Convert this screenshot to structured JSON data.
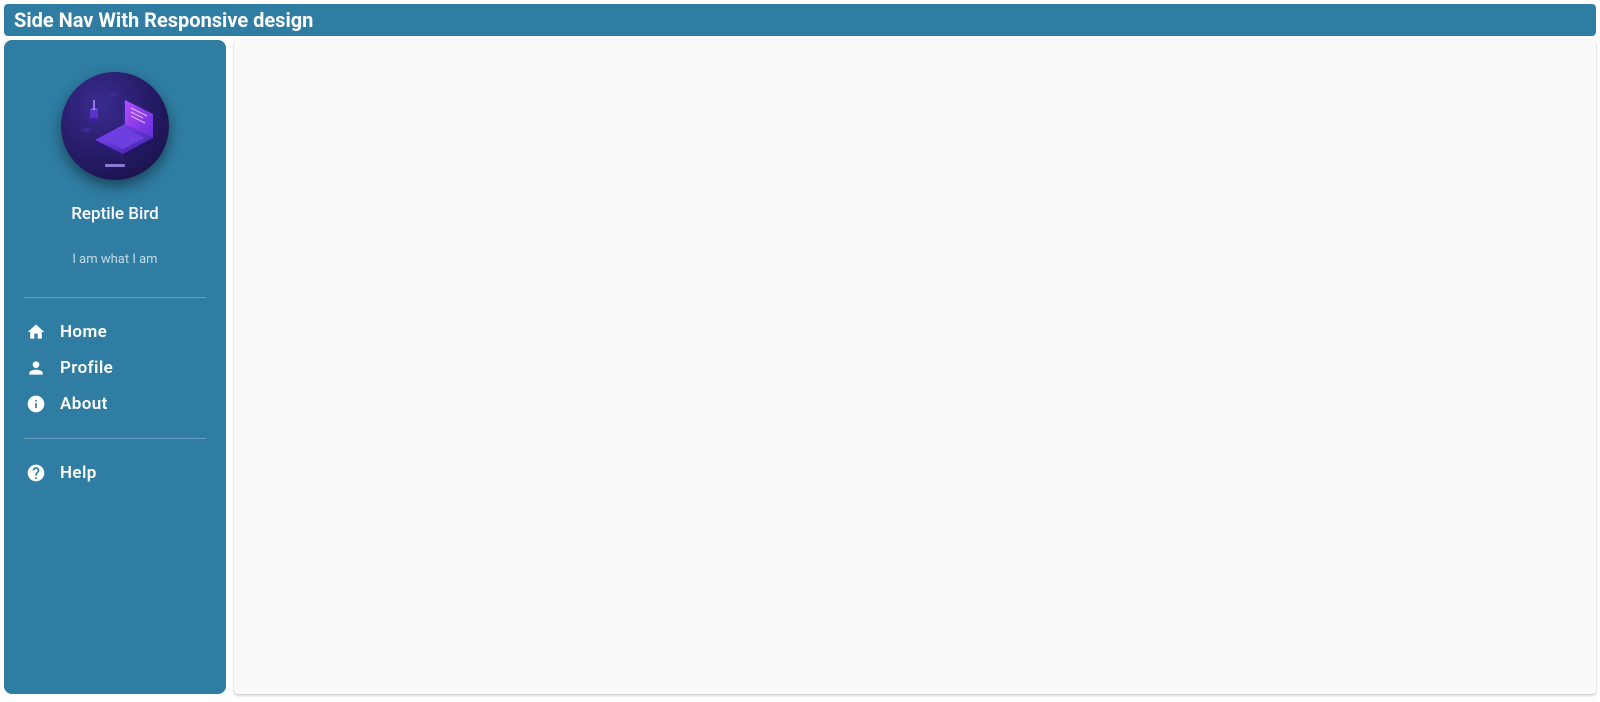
{
  "header": {
    "title": "Side Nav With Responsive design"
  },
  "profile": {
    "name": "Reptile Bird",
    "tagline": "I am what I am"
  },
  "nav": {
    "groups": [
      [
        {
          "icon": "home",
          "label": "Home"
        },
        {
          "icon": "person",
          "label": "Profile"
        },
        {
          "icon": "info",
          "label": "About"
        }
      ],
      [
        {
          "icon": "help",
          "label": "Help"
        }
      ]
    ]
  }
}
